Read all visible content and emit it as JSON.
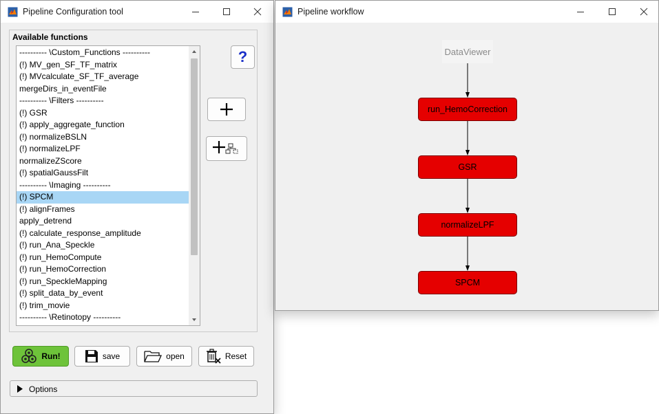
{
  "config_window": {
    "title": "Pipeline Configuration tool",
    "panel_title": "Available functions",
    "functions": [
      "---------- \\Custom_Functions ----------",
      "(!) MV_gen_SF_TF_matrix",
      "(!) MVcalculate_SF_TF_average",
      "mergeDirs_in_eventFile",
      "---------- \\Filters ----------",
      "(!) GSR",
      "(!) apply_aggregate_function",
      "(!) normalizeBSLN",
      "(!) normalizeLPF",
      "normalizeZScore",
      "(!) spatialGaussFilt",
      "---------- \\Imaging ----------",
      "(!) SPCM",
      "(!) alignFrames",
      "apply_detrend",
      "(!) calculate_response_amplitude",
      "(!) run_Ana_Speckle",
      "(!) run_HemoCompute",
      "(!) run_HemoCorrection",
      "(!) run_SpeckleMapping",
      "(!) split_data_by_event",
      "(!) trim_movie",
      "---------- \\Retinotopy ----------"
    ],
    "selected_function": "(!) SPCM",
    "help_label": "?",
    "run_label": "Run!",
    "save_label": "save",
    "open_label": "open",
    "reset_label": "Reset",
    "options_label": "Options"
  },
  "workflow_window": {
    "title": "Pipeline workflow",
    "nodes": [
      "DataViewer",
      "run_HemoCorrection",
      "GSR",
      "normalizeLPF",
      "SPCM"
    ]
  },
  "colors": {
    "node_fill": "#e50000",
    "node_border": "#7a0000",
    "run_button": "#6ec33a",
    "selection": "#a8d6f5"
  }
}
